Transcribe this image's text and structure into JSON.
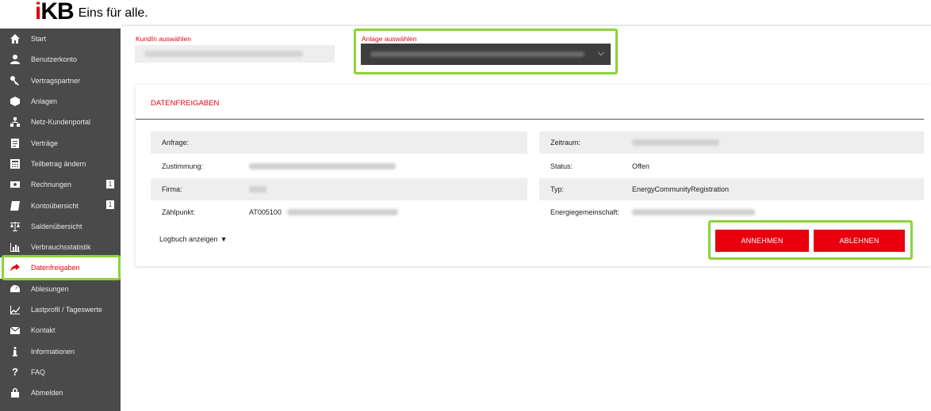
{
  "brand": {
    "logo_prefix": "i",
    "logo_main": "KB",
    "tagline": "Eins für alle."
  },
  "colors": {
    "accent": "#e30613",
    "sidebar_bg": "#4a4a4a",
    "highlight": "#8cd33a"
  },
  "sidebar": {
    "items": [
      {
        "label": "Start",
        "icon": "home-icon"
      },
      {
        "label": "Benutzerkonto",
        "icon": "user-icon"
      },
      {
        "label": "Vertragspartner",
        "icon": "key-icon"
      },
      {
        "label": "Anlagen",
        "icon": "cube-icon"
      },
      {
        "label": "Netz-Kundenportal",
        "icon": "network-icon"
      },
      {
        "label": "Verträge",
        "icon": "document-icon"
      },
      {
        "label": "Teilbetrag ändern",
        "icon": "calculator-icon"
      },
      {
        "label": "Rechnungen",
        "icon": "money-icon",
        "badge": "1"
      },
      {
        "label": "Kontoübersicht",
        "icon": "book-icon",
        "badge": "1"
      },
      {
        "label": "Saldenübersicht",
        "icon": "scale-icon"
      },
      {
        "label": "Verbrauchsstatistik",
        "icon": "bar-chart-icon"
      },
      {
        "label": "Datenfreigaben",
        "icon": "share-arrow-icon",
        "active": true
      },
      {
        "label": "Ablesungen",
        "icon": "gauge-icon"
      },
      {
        "label": "Lastprofil / Tageswerte",
        "icon": "line-chart-icon"
      },
      {
        "label": "Kontakt",
        "icon": "envelope-icon"
      },
      {
        "label": "Informationen",
        "icon": "info-icon"
      },
      {
        "label": "FAQ",
        "icon": "question-icon"
      },
      {
        "label": "Abmelden",
        "icon": "lock-icon"
      }
    ]
  },
  "selectors": {
    "kunde_label": "KundIn auswählen",
    "anlage_label": "Anlage auswählen"
  },
  "card": {
    "title": "DATENFREIGABEN",
    "left": [
      {
        "label": "Anfrage:",
        "value": ""
      },
      {
        "label": "Zustimmung:",
        "value": ""
      },
      {
        "label": "Firma:",
        "value": ""
      },
      {
        "label": "Zählpunkt:",
        "value": "AT005100"
      }
    ],
    "right": [
      {
        "label": "Zeitraum:",
        "value": ""
      },
      {
        "label": "Status:",
        "value": "Offen"
      },
      {
        "label": "Typ:",
        "value": "EnergyCommunityRegistration"
      },
      {
        "label": "Energiegemeinschaft:",
        "value": ""
      }
    ],
    "logbuch": "Logbuch anzeigen",
    "accept": "ANNEHMEN",
    "reject": "ABLEHNEN"
  }
}
